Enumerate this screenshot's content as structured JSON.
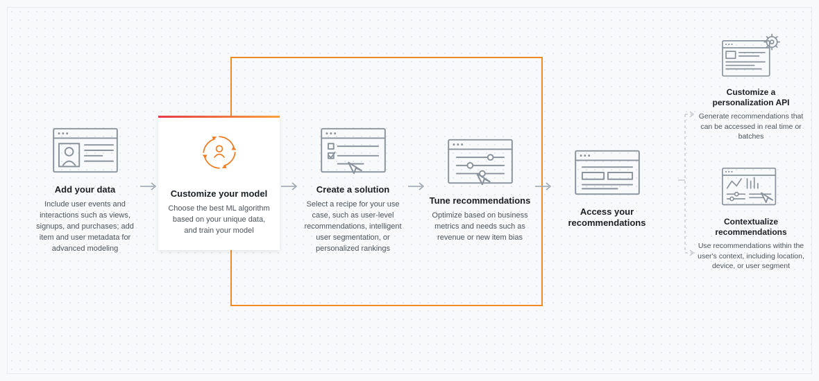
{
  "steps": [
    {
      "title": "Add your data",
      "desc": "Include user events and interactions such as views, signups, and purchases; add item and user metadata for advanced modeling"
    },
    {
      "title": "Customize your model",
      "desc": "Choose the best ML algorithm based on your unique data, and train your model"
    },
    {
      "title": "Create a solution",
      "desc": "Select a recipe for your use case, such as user-level recommendations, intelligent user segmentation, or personalized rankings"
    },
    {
      "title": "Tune recommendations",
      "desc": "Optimize based on business metrics and needs such as revenue or new item bias"
    },
    {
      "title": "Access your recommendations",
      "desc": ""
    }
  ],
  "outputs": [
    {
      "title": "Customize a personalization API",
      "desc": "Generate recommendations that can be accessed in real time or batches"
    },
    {
      "title": "Contextualize recommendations",
      "desc": "Use recommendations within the user's context, including location, device, or user segment"
    }
  ]
}
